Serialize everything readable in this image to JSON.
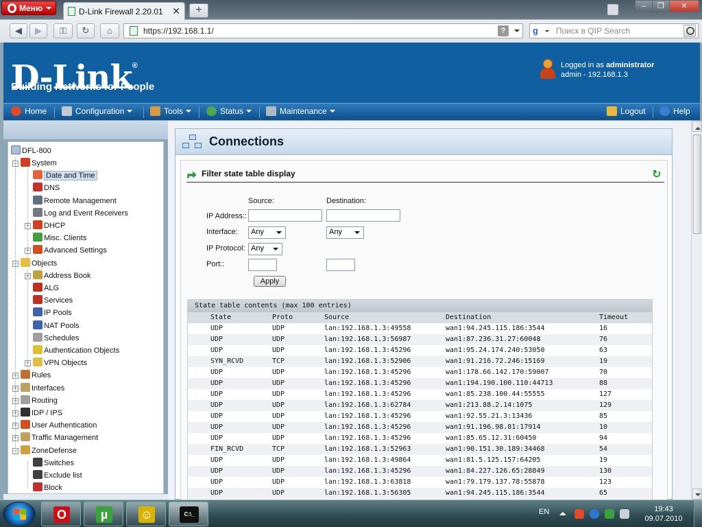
{
  "browser": {
    "menu_label": "Меню",
    "tab_title": "D-Link Firewall 2.20.01",
    "new_tab_label": "+",
    "url": "https://192.168.1.1/",
    "search_placeholder": "Поиск в QIP Search",
    "search_engine_glyph": "g",
    "win_controls": {
      "minimize": "–",
      "maximize": "❐",
      "close": "✕"
    }
  },
  "header": {
    "logo": "D-Link",
    "logo_mark": "®",
    "tagline": "Building Networks for People",
    "logged_in_prefix": "Logged in as",
    "user": "administrator",
    "session": "admin - 192.168.1.3"
  },
  "menu": {
    "home": "Home",
    "configuration": "Configuration",
    "tools": "Tools",
    "status": "Status",
    "maintenance": "Maintenance",
    "logout": "Logout",
    "help": "Help"
  },
  "sidebar": {
    "root": "DFL-800",
    "items": [
      {
        "label": "System",
        "level": 1,
        "expander": "−",
        "icon_color": "#d04020"
      },
      {
        "label": "Date and Time",
        "level": 2,
        "selected": true,
        "icon_color": "#e86040"
      },
      {
        "label": "DNS",
        "level": 2,
        "icon_color": "#c83030"
      },
      {
        "label": "Remote Management",
        "level": 2,
        "icon_color": "#607080"
      },
      {
        "label": "Log and Event Receivers",
        "level": 2,
        "icon_color": "#707880"
      },
      {
        "label": "DHCP",
        "level": 2,
        "expander": "+",
        "icon_color": "#d04020"
      },
      {
        "label": "Misc. Clients",
        "level": 2,
        "icon_color": "#40a040"
      },
      {
        "label": "Advanced Settings",
        "level": 2,
        "expander": "+",
        "icon_color": "#d05020"
      },
      {
        "label": "Objects",
        "level": 1,
        "expander": "−",
        "icon_color": "#e8c040"
      },
      {
        "label": "Address Book",
        "level": 2,
        "expander": "+",
        "icon_color": "#c0a040"
      },
      {
        "label": "ALG",
        "level": 2,
        "icon_color": "#c03020"
      },
      {
        "label": "Services",
        "level": 2,
        "icon_color": "#c03020"
      },
      {
        "label": "IP Pools",
        "level": 2,
        "icon_color": "#4060b0"
      },
      {
        "label": "NAT Pools",
        "level": 2,
        "icon_color": "#4060b0"
      },
      {
        "label": "Schedules",
        "level": 2,
        "icon_color": "#a0a0a0"
      },
      {
        "label": "Authentication Objects",
        "level": 2,
        "icon_color": "#e0c030"
      },
      {
        "label": "VPN Objects",
        "level": 2,
        "expander": "+",
        "icon_color": "#e0c040"
      },
      {
        "label": "Rules",
        "level": 1,
        "expander": "+",
        "icon_color": "#c07030"
      },
      {
        "label": "Interfaces",
        "level": 1,
        "expander": "+",
        "icon_color": "#c0a060"
      },
      {
        "label": "Routing",
        "level": 1,
        "expander": "+",
        "icon_color": "#a0a0a0"
      },
      {
        "label": "IDP / IPS",
        "level": 1,
        "expander": "+",
        "icon_color": "#303030"
      },
      {
        "label": "User Authentication",
        "level": 1,
        "expander": "+",
        "icon_color": "#d05020"
      },
      {
        "label": "Traffic Management",
        "level": 1,
        "expander": "+",
        "icon_color": "#c0a060"
      },
      {
        "label": "ZoneDefense",
        "level": 1,
        "expander": "−",
        "icon_color": "#d0a040"
      },
      {
        "label": "Switches",
        "level": 2,
        "icon_color": "#404040"
      },
      {
        "label": "Exclude list",
        "level": 2,
        "icon_color": "#404040"
      },
      {
        "label": "Block",
        "level": 2,
        "icon_color": "#c03030"
      }
    ]
  },
  "page": {
    "title": "Connections",
    "filter_title": "Filter state table display",
    "source_label": "Source:",
    "destination_label": "Destination:",
    "ip_address_label": "IP Address::",
    "interface_label": "Interface:",
    "ip_protocol_label": "IP Protocol:",
    "port_label": "Port::",
    "source_ip": "",
    "destination_ip": "",
    "source_interface": "Any",
    "destination_interface": "Any",
    "ip_protocol": "Any",
    "source_port": "",
    "destination_port": "",
    "apply_label": "Apply"
  },
  "state_table": {
    "caption": "State table contents (max 100 entries)",
    "columns": [
      "State",
      "Proto",
      "Source",
      "Destination",
      "Timeout"
    ],
    "rows": [
      [
        "UDP",
        "UDP",
        "lan:192.168.1.3:49558",
        "wan1:94.245.115.186:3544",
        "16"
      ],
      [
        "UDP",
        "UDP",
        "lan:192.168.1.3:56987",
        "wan1:87.236.31.27:60048",
        "76"
      ],
      [
        "UDP",
        "UDP",
        "lan:192.168.1.3:45296",
        "wan1:95.24.174.240:53050",
        "63"
      ],
      [
        "SYN_RCVD",
        "TCP",
        "lan:192.168.1.3:52906",
        "wan1:91.216.72.246:15169",
        "19"
      ],
      [
        "UDP",
        "UDP",
        "lan:192.168.1.3:45296",
        "wan1:178.66.142.170:59007",
        "70"
      ],
      [
        "UDP",
        "UDP",
        "lan:192.168.1.3:45296",
        "wan1:194.190.100.110:44713",
        "88"
      ],
      [
        "UDP",
        "UDP",
        "lan:192.168.1.3:45296",
        "wan1:85.238.100.44:55555",
        "127"
      ],
      [
        "UDP",
        "UDP",
        "lan:192.168.1.3:62784",
        "wan1:213.88.2.14:1075",
        "129"
      ],
      [
        "UDP",
        "UDP",
        "lan:192.168.1.3:45296",
        "wan1:92.55.21.3:13436",
        "85"
      ],
      [
        "UDP",
        "UDP",
        "lan:192.168.1.3:45296",
        "wan1:91.196.98.81:17914",
        "10"
      ],
      [
        "UDP",
        "UDP",
        "lan:192.168.1.3:45296",
        "wan1:85.65.12.31:60450",
        "94"
      ],
      [
        "FIN_RCVD",
        "TCP",
        "lan:192.168.1.3:52963",
        "wan1:90.151.30.189:34468",
        "54"
      ],
      [
        "UDP",
        "UDP",
        "lan:192.168.1.3:49864",
        "wan1:81.5.125.157:64205",
        "19"
      ],
      [
        "UDP",
        "UDP",
        "lan:192.168.1.3:45296",
        "wan1:84.227.126.65:28849",
        "130"
      ],
      [
        "UDP",
        "UDP",
        "lan:192.168.1.3:63818",
        "wan1:79.179.137.78:55878",
        "123"
      ],
      [
        "UDP",
        "UDP",
        "lan:192.168.1.3:56305",
        "wan1:94.245.115.186:3544",
        "65"
      ]
    ]
  },
  "taskbar": {
    "apps": [
      {
        "name": "opera",
        "glyph": "O",
        "color": "#cc0f16"
      },
      {
        "name": "utorrent",
        "glyph": "µ",
        "color": "#3aa23a"
      },
      {
        "name": "qip",
        "glyph": "☺",
        "color": "#d8b400"
      },
      {
        "name": "cmd",
        "glyph": "C:\\_",
        "color": "#111111"
      }
    ],
    "language": "EN",
    "time": "19:43",
    "date": "09.07.2010"
  },
  "colors": {
    "dlink_blue": "#0f5fa1",
    "menubar": "#1f66a8",
    "selected": "#cfe0f4"
  }
}
